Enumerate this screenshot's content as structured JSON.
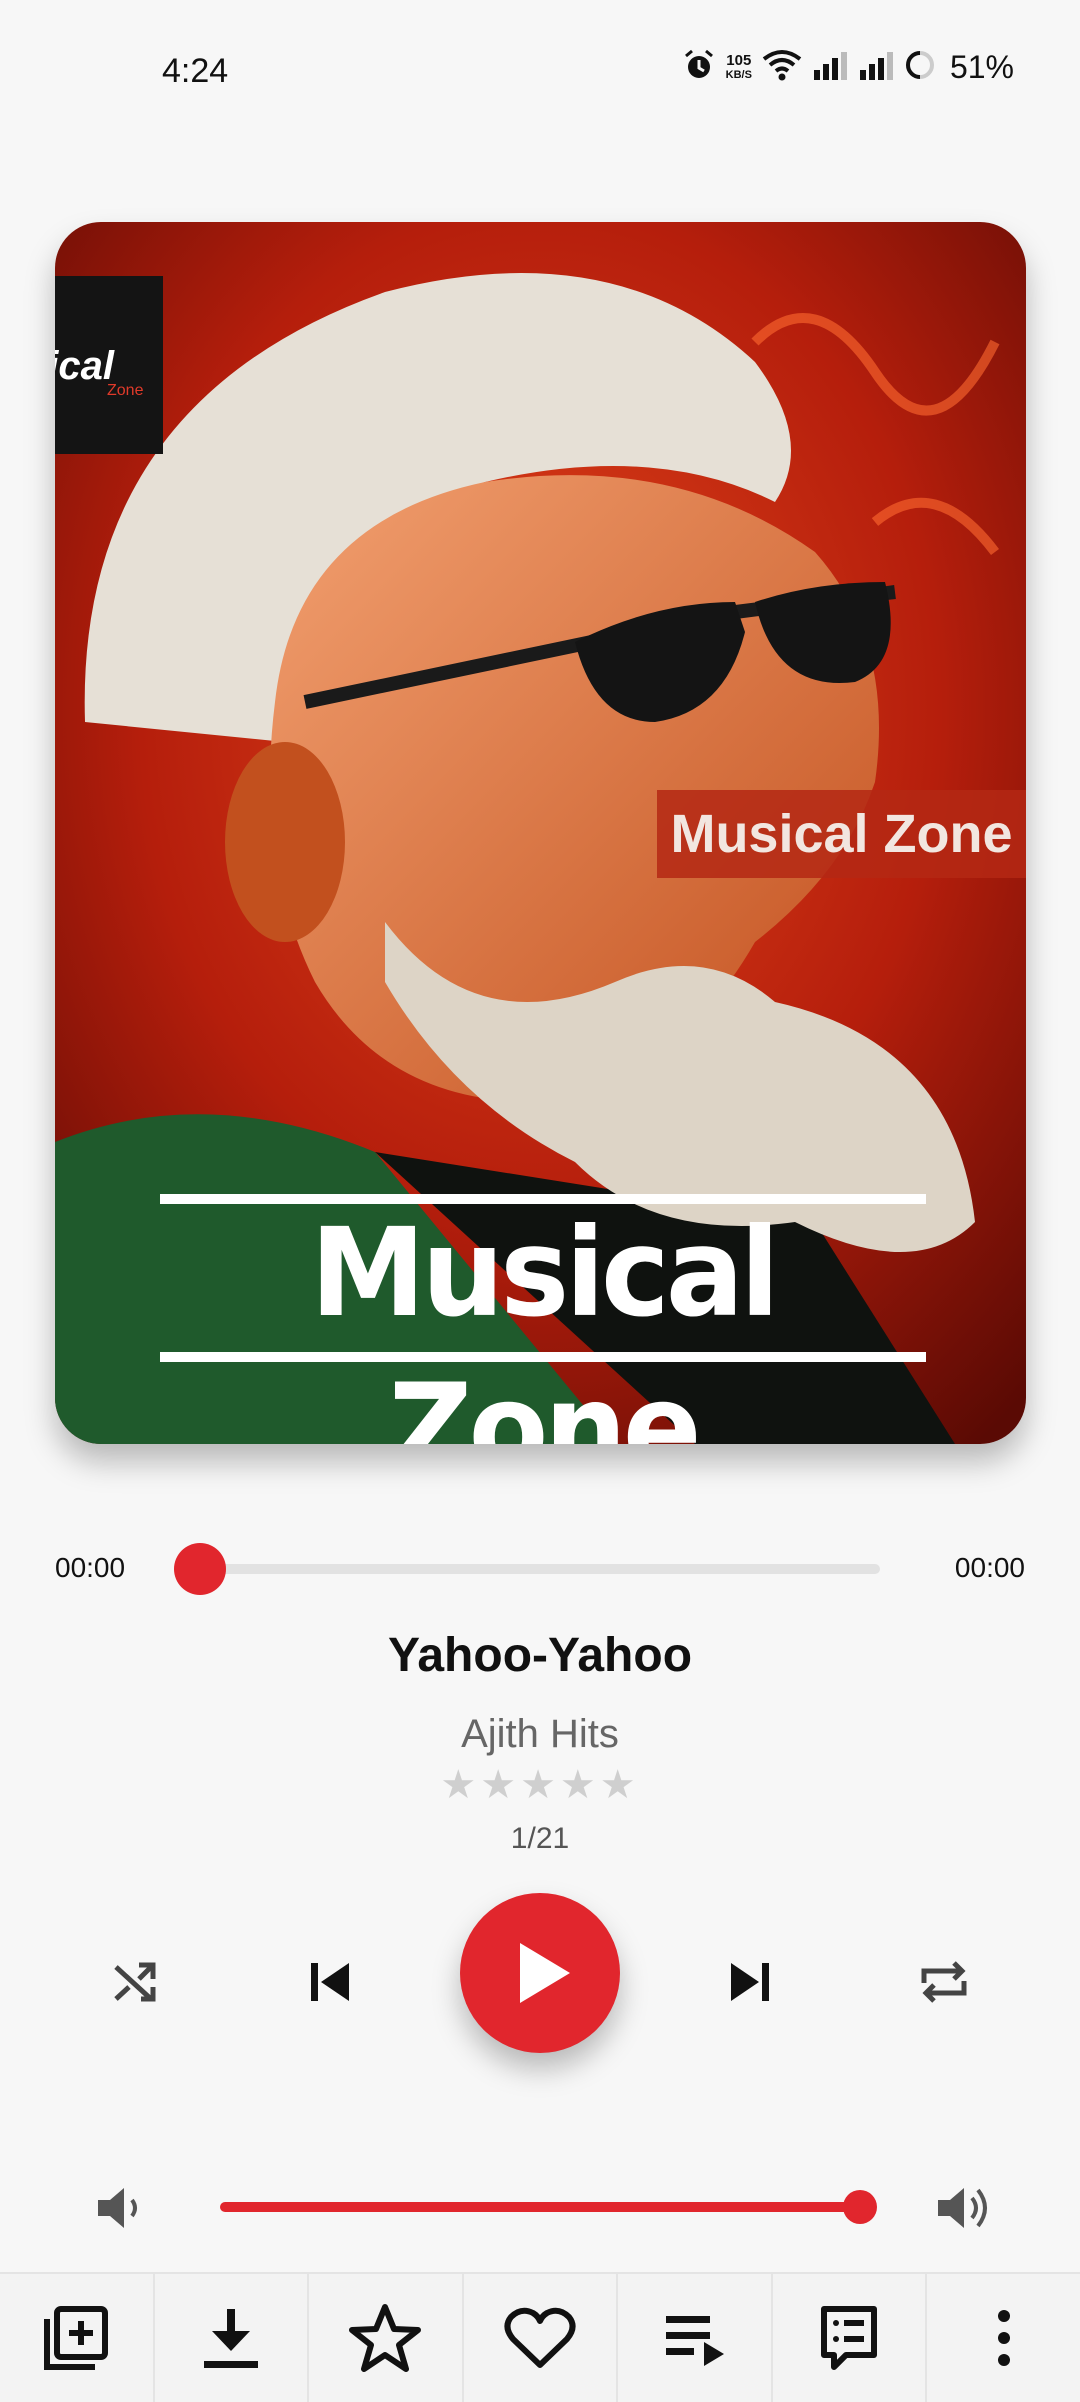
{
  "status_bar": {
    "time": "4:24",
    "speed_value": "105",
    "speed_unit": "KB/S",
    "battery": "51%"
  },
  "artwork": {
    "logo_text": "sical",
    "logo_subtext": "Zone",
    "tag_text": "Musical Zone",
    "banner_text": "Musical Zone"
  },
  "player": {
    "elapsed": "00:00",
    "duration": "00:00",
    "progress_fraction": 0,
    "title": "Yahoo-Yahoo",
    "artist": "Ajith Hits",
    "rating_stars": "★★★★★",
    "rating": 0,
    "track_position": "1/21",
    "volume_fraction": 1.0
  },
  "colors": {
    "accent": "#e1262d",
    "background": "#f7f7f7"
  },
  "bottom_bar": {
    "items": [
      "add-to-playlist-icon",
      "download-icon",
      "star-icon",
      "heart-icon",
      "queue-icon",
      "lyrics-icon",
      "more-icon"
    ]
  }
}
